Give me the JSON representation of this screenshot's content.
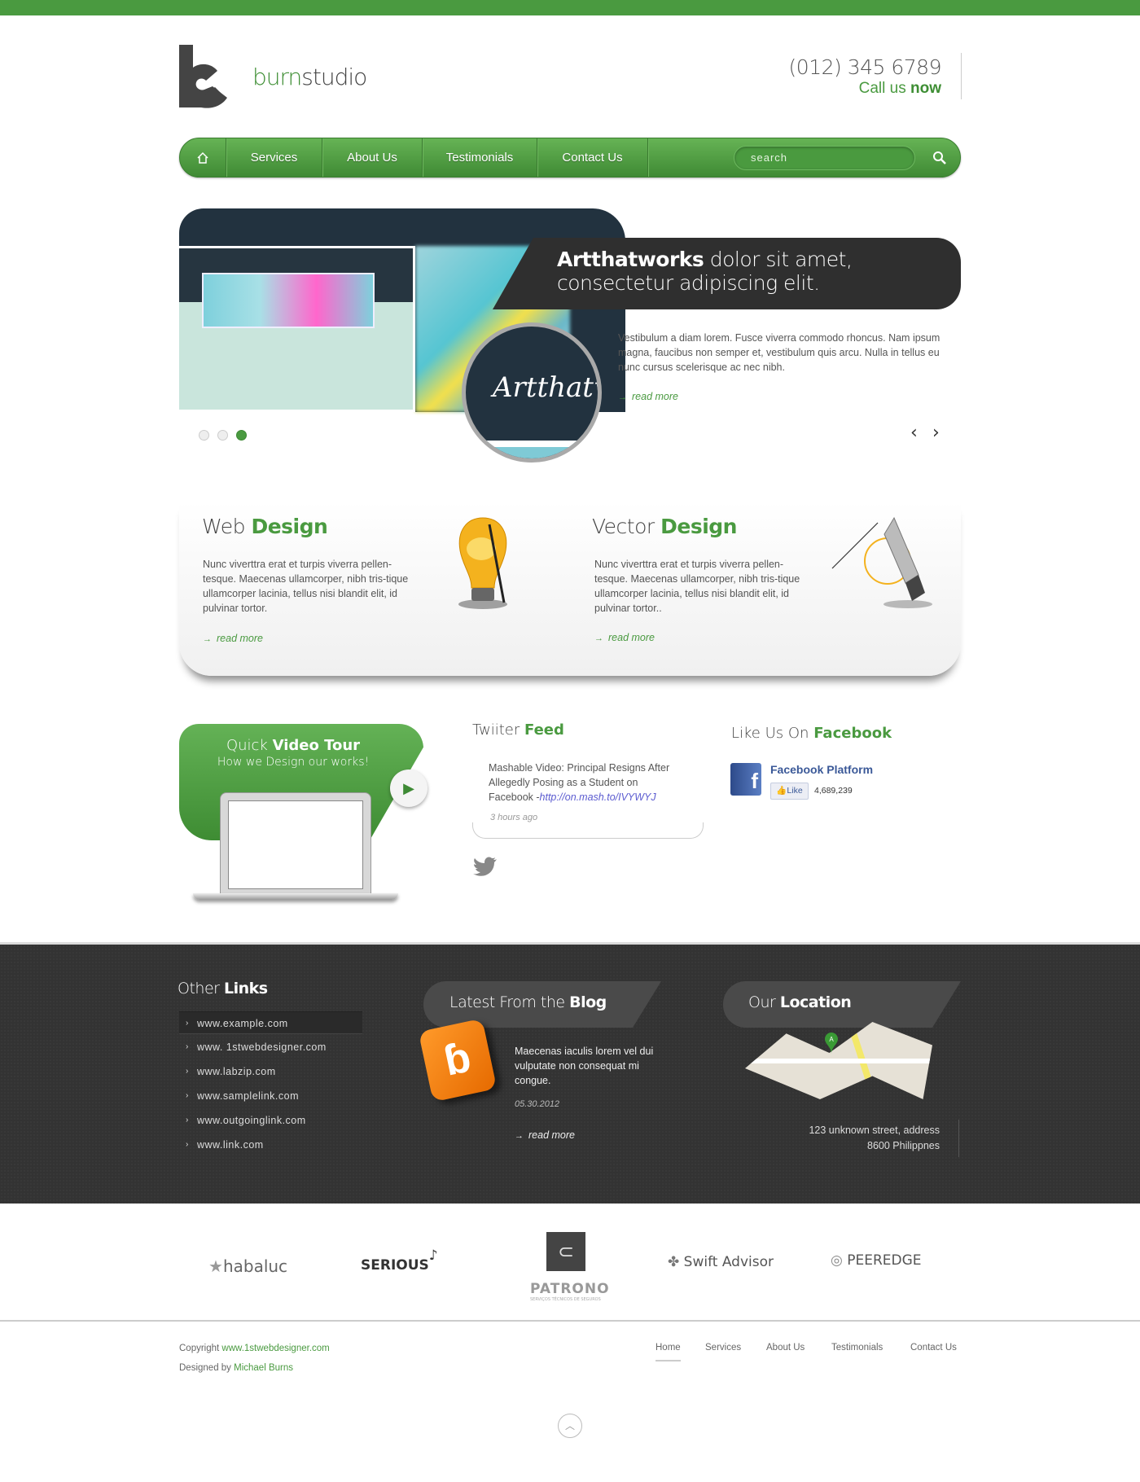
{
  "header": {
    "brand_part1": "burn",
    "brand_part2": "studio",
    "phone": "(012) 345 6789",
    "call_us": "Call us",
    "call_now": "now"
  },
  "nav": {
    "home_icon": "home-icon",
    "items": [
      {
        "label": "Services"
      },
      {
        "label": "About Us"
      },
      {
        "label": "Testimonials"
      },
      {
        "label": "Contact Us"
      }
    ],
    "search_placeholder": "search",
    "search_icon": "magnifier-icon"
  },
  "slider": {
    "caption_bold": "Artthatworks",
    "caption_rest": " dolor sit amet, consectetur adipiscing elit.",
    "lens_text": "Artthatw",
    "paragraph": "Vestibulum a diam lorem. Fusce viverra commodo rhoncus. Nam ipsum magna, faucibus non semper et, vestibulum quis arcu. Nulla in tellus eu nunc cursus scelerisque ac nec nibh.",
    "read_more": "read more",
    "active_slide": 3,
    "slide_count": 3
  },
  "services": [
    {
      "title_light": "Web ",
      "title_bold": "Design",
      "text": "Nunc viverttra erat et turpis viverra pellen-tesque. Maecenas ullamcorper, nibh tris-tique ullamcorper lacinia, tellus nisi blandit elit, id pulvinar tortor.",
      "read_more": "read more",
      "icon": "light-bulb-icon"
    },
    {
      "title_light": "Vector ",
      "title_bold": "Design",
      "text": "Nunc viverttra erat et turpis viverra pellen-tesque. Maecenas ullamcorper, nibh tris-tique ullamcorper lacinia, tellus nisi blandit elit, id pulvinar tortor..",
      "read_more": "read more",
      "icon": "pen-tool-icon"
    }
  ],
  "video": {
    "title_light": "Quick ",
    "title_bold": "Video Tour",
    "subtitle": "How we Design our works!"
  },
  "twitter": {
    "title_light": "Twiiter ",
    "title_bold": "Feed",
    "tweet": "Mashable Video: Principal Resigns After Allegedly Posing as a Student on Facebook -",
    "link": "http://on.mash.to/IVYWYJ",
    "time": "3 hours ago"
  },
  "facebook": {
    "title_light": "Like Us On ",
    "title_bold": "Facebook",
    "page_name": "Facebook Platform",
    "like_label": "Like",
    "like_count": "4,689,239"
  },
  "footer_dark": {
    "links_title_light": "Other ",
    "links_title_bold": "Links",
    "links": [
      "www.example.com",
      "www. 1stwebdesigner.com",
      "www.labzip.com",
      "www.samplelink.com",
      "www.outgoinglink.com",
      "www.link.com"
    ],
    "blog_title_light": "Latest From the ",
    "blog_title_bold": "Blog",
    "blog_text": "Maecenas iaculis lorem vel dui vulputate non consequat mi congue.",
    "blog_date": "05.30.2012",
    "blog_read_more": "read more",
    "location_title_light": "Our ",
    "location_title_bold": "Location",
    "address_line1": "123 unknown street, address",
    "address_line2": "8600 Philippnes"
  },
  "partners": [
    "habaluc",
    "SERIOUS",
    "PATRONO",
    "Swift Advisor",
    "PEEREDGE"
  ],
  "partners_sub": "SERVIÇOS TÉCNICOS DE SEGUROS",
  "footer": {
    "copyright_label": "Copyright ",
    "copyright_link": "www.1stwebdesigner.com",
    "designed_label": "Designed by ",
    "designer": "Michael Burns",
    "nav": [
      "Home",
      "Services",
      "About Us",
      "Testimonials",
      "Contact Us"
    ]
  },
  "colors": {
    "accent": "#4a9a40",
    "dark": "#333333",
    "caption_bg": "#2f2f2f"
  }
}
